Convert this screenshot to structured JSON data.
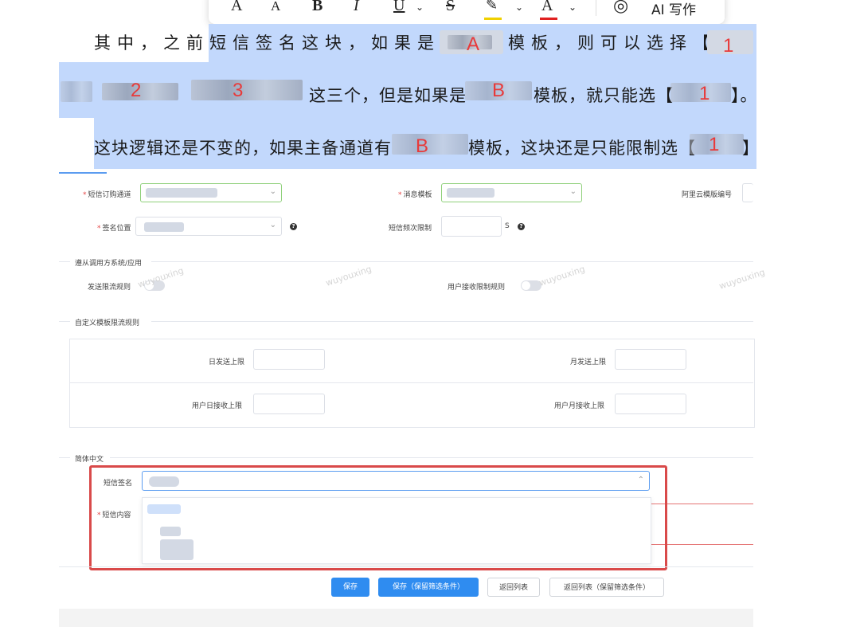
{
  "toolbar": {
    "font_a1": "A",
    "font_a2": "A",
    "bold": "B",
    "italic": "I",
    "underline": "U",
    "strike": "S",
    "ai_label": "AI 写作"
  },
  "doc": {
    "line1_a": "其中，之前短信签名这块，如果是",
    "line1_b": "模板，则可以选择【",
    "line2_a": "这三个，但是如果是",
    "line2_b": "模板，就只能选【",
    "line2_end": "】。",
    "line3_a": "这块逻辑还是不变的，如果主备通道有",
    "line3_b": "模板，这块还是只能限制选【",
    "line3_end": "】",
    "markers": {
      "a": "A",
      "b1": "B",
      "b2": "B",
      "n1": "1",
      "n2": "2",
      "n3": "3",
      "n4": "1",
      "n5": "1"
    }
  },
  "form": {
    "channel_label": "短信订购通道",
    "template_label": "消息模板",
    "aliyun_label": "阿里云模版编号",
    "sign_pos_label": "签名位置",
    "freq_label": "短信频次限制",
    "freq_unit": "S",
    "help_glyph": "?",
    "section_caller": "遵从调用方系统/应用",
    "send_limit_label": "发送限流规则",
    "user_recv_label": "用户接收限制规则",
    "section_custom": "自定义模板限流规则",
    "daily_send_label": "日发送上限",
    "monthly_send_label": "月发送上限",
    "user_daily_label": "用户日接收上限",
    "user_monthly_label": "用户月接收上限",
    "section_lang": "简体中文",
    "sms_sign_label": "短信签名",
    "sms_content_label": "短信内容",
    "watermark": "wuyouxing"
  },
  "buttons": {
    "save": "保存",
    "save_keep": "保存（保留筛选条件）",
    "back": "返回列表",
    "back_keep": "返回列表（保留筛选条件）"
  },
  "colors": {
    "selection": "#c2d8fc",
    "primary": "#2f8cf0",
    "highlight_box": "#d94a4a",
    "marker": "#e83a3a"
  }
}
